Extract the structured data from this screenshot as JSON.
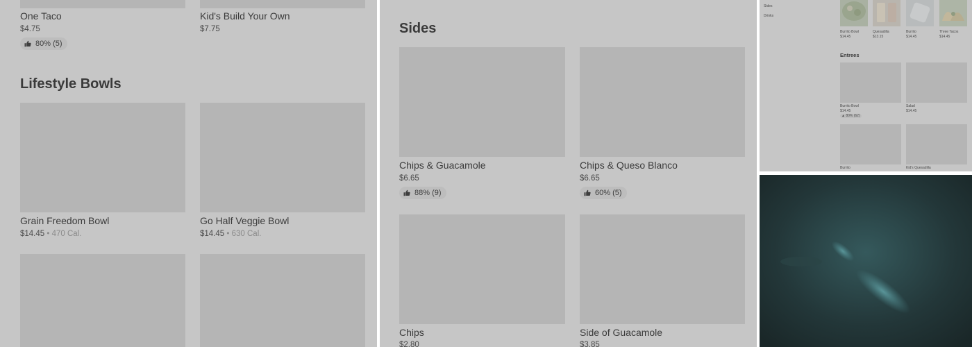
{
  "panel1": {
    "top_items": [
      {
        "name": "One Taco",
        "price": "$4.75",
        "rating": "80% (5)"
      },
      {
        "name": "Kid's Build Your Own",
        "price": "$7.75"
      }
    ],
    "section_title": "Lifestyle Bowls",
    "items": [
      {
        "name": "Grain Freedom Bowl",
        "price": "$14.45",
        "cal": "470 Cal."
      },
      {
        "name": "Go Half Veggie Bowl",
        "price": "$14.45",
        "cal": "630 Cal."
      }
    ],
    "sep": "•"
  },
  "panel2": {
    "section_title": "Sides",
    "items": [
      {
        "name": "Chips & Guacamole",
        "price": "$6.65",
        "rating": "88% (9)"
      },
      {
        "name": "Chips & Queso Blanco",
        "price": "$6.65",
        "rating": "60% (5)"
      },
      {
        "name": "Chips",
        "price": "$2.80"
      },
      {
        "name": "Side of Guacamole",
        "price": "$3.85"
      }
    ]
  },
  "panel3": {
    "sidebar": [
      "Sides",
      "Drinks"
    ],
    "top_items": [
      {
        "name": "Burrito Bowl",
        "price": "$14.45"
      },
      {
        "name": "Quesadilla",
        "price": "$13.15"
      },
      {
        "name": "Burrito",
        "price": "$14.45"
      },
      {
        "name": "Three Tacos",
        "price": "$14.45"
      }
    ],
    "section_title": "Entrees",
    "entrees": [
      {
        "name": "Burrito Bowl",
        "price": "$14.45",
        "rating": "80% (62)"
      },
      {
        "name": "Salad",
        "price": "$14.45"
      }
    ],
    "bottom_items": [
      {
        "name": "Burrito"
      },
      {
        "name": "Kid's Quesadilla"
      }
    ]
  },
  "colors": {
    "dim_overlay": "#c6c6c6",
    "placeholder": "#b5b5b5",
    "photo_dark": "#1f2e2f",
    "photo_glow": "#4f8c91"
  }
}
